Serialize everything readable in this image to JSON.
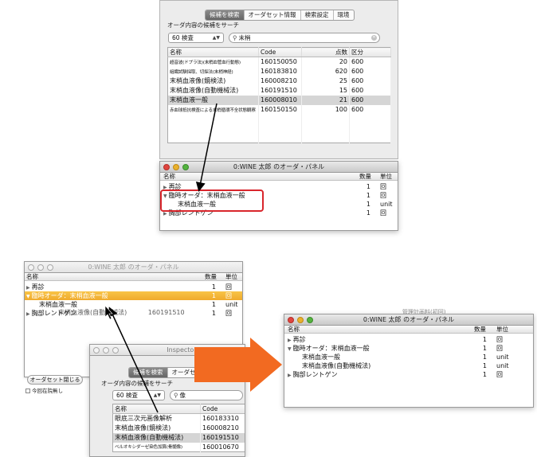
{
  "colors": {
    "accent_orange": "#f0a62e",
    "annotation_red": "#d9262c",
    "arrow_orange": "#f26a21"
  },
  "search_panel_top": {
    "tabs": [
      {
        "label": "候補を検索",
        "selected": true
      },
      {
        "label": "オーダセット情報",
        "selected": false
      },
      {
        "label": "検索設定",
        "selected": false
      },
      {
        "label": "環境",
        "selected": false
      }
    ],
    "section_title": "オーダ内容の候補をサーチ",
    "search_scope": "60 検査",
    "search_value": "末梢",
    "columns": [
      "名称",
      "Code",
      "点数",
      "区分"
    ],
    "rows": [
      {
        "name": "超音波(ドプラ法)(末梢血管血行動態)",
        "code": "160150050",
        "points": "20",
        "category": "600",
        "small": true
      },
      {
        "name": "組織試験採取、切採法(末梢神経)",
        "code": "160183810",
        "points": "620",
        "category": "600",
        "small": true
      },
      {
        "name": "末梢血液像(鏡検法)",
        "code": "160008210",
        "points": "25",
        "category": "600",
        "small": false
      },
      {
        "name": "末梢血液像(自動機械法)",
        "code": "160191510",
        "points": "15",
        "category": "600",
        "small": false
      },
      {
        "name": "末梢血液一般",
        "code": "160008010",
        "points": "21",
        "category": "600",
        "small": false,
        "selected": true
      },
      {
        "name": "赤血球抵抗検査による末梢循環不全状態観察",
        "code": "160150150",
        "points": "100",
        "category": "600",
        "small": true
      }
    ]
  },
  "order_panel_top": {
    "title": "0:WINE 太郎 のオーダ・パネル",
    "columns": [
      "名称",
      "数量",
      "単位"
    ],
    "rows": [
      {
        "name": "再診",
        "qty": "1",
        "unit": "回",
        "disclosure": "▶"
      },
      {
        "name": "臨時オーダ：末梢血液一般",
        "qty": "1",
        "unit": "回",
        "disclosure": "▼"
      },
      {
        "name": "末梢血液一般",
        "qty": "1",
        "unit": "unit",
        "disclosure": ""
      },
      {
        "name": "胸部レントゲン",
        "qty": "1",
        "unit": "回",
        "disclosure": "▶"
      }
    ]
  },
  "order_panel_left": {
    "title": "0:WINE 太郎 のオーダ・パネル",
    "columns": [
      "名称",
      "数量",
      "単位"
    ],
    "rows": [
      {
        "name": "再診",
        "qty": "1",
        "unit": "回",
        "disclosure": "▶"
      },
      {
        "name": "臨時オーダ：末梢血液一般",
        "qty": "1",
        "unit": "回",
        "disclosure": "▼",
        "highlight": true
      },
      {
        "name": "末梢血液一般",
        "qty": "1",
        "unit": "unit",
        "disclosure": ""
      },
      {
        "name": "胸部レントゲン",
        "qty": "1",
        "unit": "回",
        "disclosure": "▶"
      }
    ],
    "drag_ghost_name": "末梢血液像(自動機械法)",
    "drag_ghost_code": "160191510",
    "close_button": "オーダセット閉じる",
    "checkbox_label": "今回在院無し"
  },
  "inspector": {
    "title": "Inspector Panel",
    "tabs": [
      {
        "label": "候補を検索",
        "selected": true
      },
      {
        "label": "オーダセ",
        "selected": false
      }
    ],
    "section_title": "オーダ内容の候補をサーチ",
    "search_scope": "60 検査",
    "search_value": "像",
    "columns": [
      "名称",
      "Code"
    ],
    "rows": [
      {
        "name": "眼底三次元画像解析",
        "code": "160183310"
      },
      {
        "name": "末梢血液像(鏡検法)",
        "code": "160008210"
      },
      {
        "name": "末梢血液像(自動機械法)",
        "code": "160191510",
        "selected": true
      },
      {
        "name": "ベルオキシダーゼ染色加算(骨髄像)",
        "code": "160010670",
        "small": true
      }
    ]
  },
  "order_panel_result": {
    "title": "0:WINE 太郎 のオーダ・パネル",
    "columns": [
      "名称",
      "数量",
      "単位"
    ],
    "rows": [
      {
        "name": "再診",
        "qty": "1",
        "unit": "回",
        "disclosure": "▶"
      },
      {
        "name": "臨時オーダ：末梢血液一般",
        "qty": "1",
        "unit": "回",
        "disclosure": "▼"
      },
      {
        "name": "末梢血液一般",
        "qty": "1",
        "unit": "unit",
        "disclosure": ""
      },
      {
        "name": "末梢血液像(自動機械法)",
        "qty": "1",
        "unit": "unit",
        "disclosure": ""
      },
      {
        "name": "胸部レントゲン",
        "qty": "1",
        "unit": "回",
        "disclosure": "▶"
      }
    ],
    "partial_text_behind": "管理計画料(初回)"
  }
}
